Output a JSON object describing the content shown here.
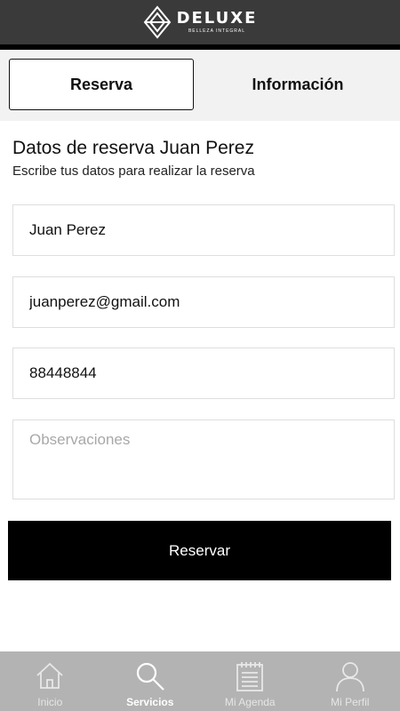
{
  "header": {
    "brand_name": "DELUXE",
    "brand_tagline": "BELLEZA INTEGRAL",
    "logo_icon": "diamond-logo-icon"
  },
  "tabs": [
    {
      "label": "Reserva",
      "active": true
    },
    {
      "label": "Información",
      "active": false
    }
  ],
  "form": {
    "title": "Datos de reserva Juan Perez",
    "subtitle": "Escribe tus datos para realizar la reserva",
    "name_value": "Juan Perez",
    "email_value": "juanperez@gmail.com",
    "phone_value": "88448844",
    "notes_placeholder": "Observaciones",
    "submit_label": "Reservar"
  },
  "bottom_nav": [
    {
      "label": "Inicio",
      "icon": "home-icon",
      "active": false
    },
    {
      "label": "Servicios",
      "icon": "search-icon",
      "active": true
    },
    {
      "label": "Mi Agenda",
      "icon": "notepad-icon",
      "active": false
    },
    {
      "label": "Mi Perfil",
      "icon": "user-icon",
      "active": false
    }
  ],
  "colors": {
    "header_bg": "#3a3a3a",
    "button_bg": "#000000",
    "nav_bg": "#b3b3b3"
  }
}
